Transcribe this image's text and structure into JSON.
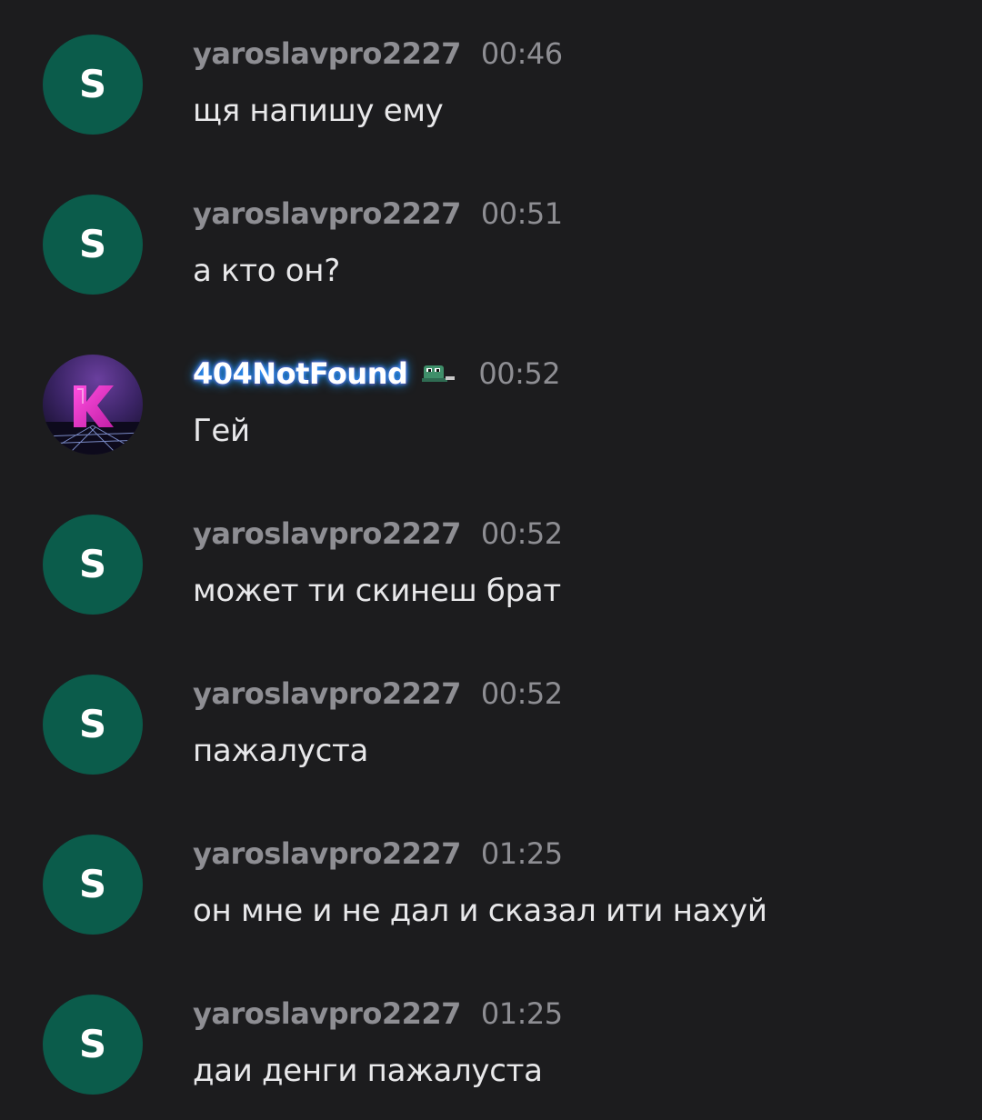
{
  "colors": {
    "background": "#1c1c1e",
    "avatar_default": "#0b5c4b",
    "username": "#8e8e93",
    "timestamp": "#8e8e93",
    "message_text": "#e8e8ea",
    "fancy_name_glow": "#1e9bff",
    "fancy_accent": "#ff2bd6"
  },
  "messages": [
    {
      "avatar_letter": "S",
      "username": "yaroslavpro2227",
      "time": "00:46",
      "text": "щя напишу ему"
    },
    {
      "avatar_letter": "S",
      "username": "yaroslavpro2227",
      "time": "00:51",
      "text": "а кто он?"
    },
    {
      "avatar_icon": "k-logo-synthwave-avatar",
      "username": "404NotFound",
      "badge_icon": "pepe-badge-icon",
      "time": "00:52",
      "text": "Гей"
    },
    {
      "avatar_letter": "S",
      "username": "yaroslavpro2227",
      "time": "00:52",
      "text": "может ти скинеш брат"
    },
    {
      "avatar_letter": "S",
      "username": "yaroslavpro2227",
      "time": "00:52",
      "text": "пажалуста"
    },
    {
      "avatar_letter": "S",
      "username": "yaroslavpro2227",
      "time": "01:25",
      "text": "он мне и не дал и сказал ити нахуй"
    },
    {
      "avatar_letter": "S",
      "username": "yaroslavpro2227",
      "time": "01:25",
      "text": "даи денги пажалуста"
    }
  ]
}
